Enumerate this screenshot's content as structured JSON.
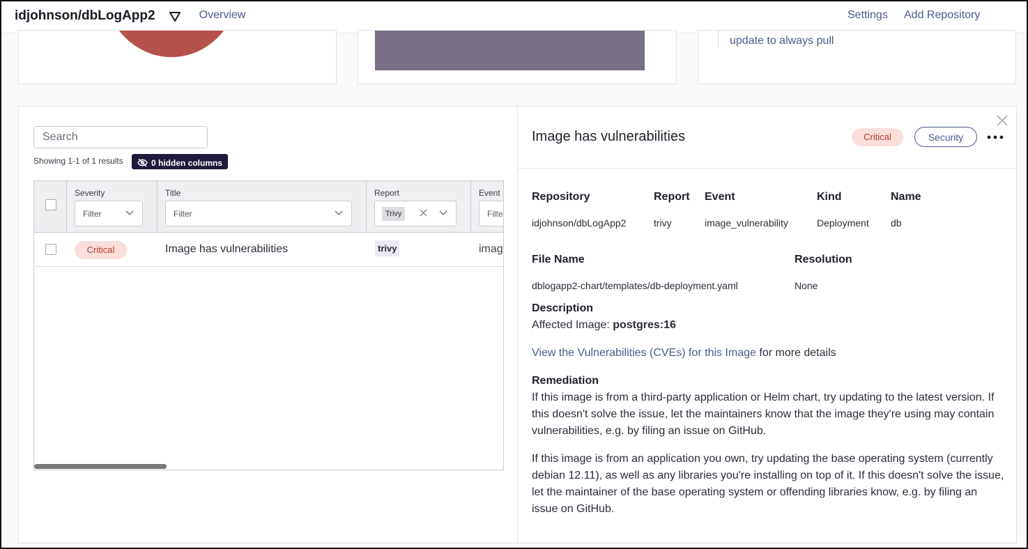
{
  "header": {
    "repo_name": "idjohnson/dbLogApp2",
    "tab_overview": "Overview",
    "settings": "Settings",
    "add_repository": "Add Repository"
  },
  "cards": {
    "card3_link": "update to always pull",
    "colors": {
      "pie": "#b5524a",
      "bar": "#786e86"
    }
  },
  "list": {
    "search_placeholder": "Search",
    "showing": "Showing 1-1 of 1 results",
    "hidden_columns": "0 hidden columns",
    "columns": {
      "severity": "Severity",
      "title": "Title",
      "report": "Report",
      "event": "Event"
    },
    "filter_placeholder": "Filter",
    "report_filter_tag": "Trivy",
    "rows": [
      {
        "severity": "Critical",
        "title": "Image has vulnerabilities",
        "report": "trivy",
        "event": "imag"
      }
    ]
  },
  "detail": {
    "title": "Image has vulnerabilities",
    "severity": "Critical",
    "category": "Security",
    "fields": {
      "repository_label": "Repository",
      "repository": "idjohnson/dbLogApp2",
      "report_label": "Report",
      "report": "trivy",
      "event_label": "Event",
      "event": "image_vulnerability",
      "kind_label": "Kind",
      "kind": "Deployment",
      "name_label": "Name",
      "name": "db",
      "file_name_label": "File Name",
      "file_name": "dblogapp2-chart/templates/db-deployment.yaml",
      "resolution_label": "Resolution",
      "resolution": "None"
    },
    "description_label": "Description",
    "affected_prefix": "Affected Image: ",
    "affected_image": "postgres:16",
    "cve_link": "View the Vulnerabilities (CVEs) for this Image",
    "cve_suffix": " for more details",
    "remediation_label": "Remediation",
    "remediation_p1": "If this image is from a third-party application or Helm chart, try updating to the latest version. If this doesn't solve the issue, let the maintainers know that the image they're using may contain vulnerabilities, e.g. by filing an issue on GitHub.",
    "remediation_p2": "If this image is from an application you own, try updating the base operating system (currently debian 12.11), as well as any libraries you're installing on top of it. If this doesn't solve the issue, let the maintainer of the base operating system or offending libraries know, e.g. by filing an issue on GitHub."
  }
}
